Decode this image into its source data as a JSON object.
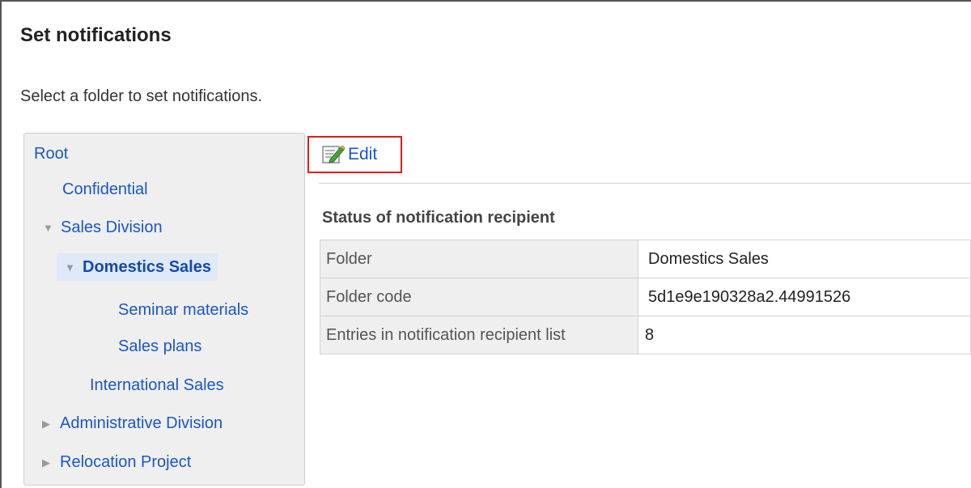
{
  "page": {
    "title": "Set notifications",
    "instruction": "Select a folder to set notifications."
  },
  "folder_tree": {
    "items": [
      {
        "label": "Root",
        "caret": "",
        "selected": false
      },
      {
        "label": "Confidential",
        "caret": "",
        "selected": false
      },
      {
        "label": "Sales Division",
        "caret": "▼",
        "selected": false
      },
      {
        "label": "Domestics Sales",
        "caret": "▼",
        "selected": true
      },
      {
        "label": "Seminar materials",
        "caret": "",
        "selected": false
      },
      {
        "label": "Sales plans",
        "caret": "",
        "selected": false
      },
      {
        "label": "International Sales",
        "caret": "",
        "selected": false
      },
      {
        "label": "Administrative Division",
        "caret": "▶",
        "selected": false
      },
      {
        "label": "Relocation Project",
        "caret": "▶",
        "selected": false
      }
    ]
  },
  "toolbar": {
    "edit_label": "Edit",
    "edit_icon": "edit-icon",
    "highlight_color": "#e01b1b"
  },
  "status_section": {
    "title": "Status of notification recipient",
    "rows": [
      {
        "label": "Folder",
        "value": "Domestics Sales"
      },
      {
        "label": "Folder code",
        "value": "5d1e9e190328a2.44991526"
      },
      {
        "label": "Entries in notification recipient list",
        "value": "8"
      }
    ]
  },
  "colors": {
    "link": "#1a56c8",
    "tree_background": "#efefef",
    "selected_background": "#dfe9f7"
  }
}
